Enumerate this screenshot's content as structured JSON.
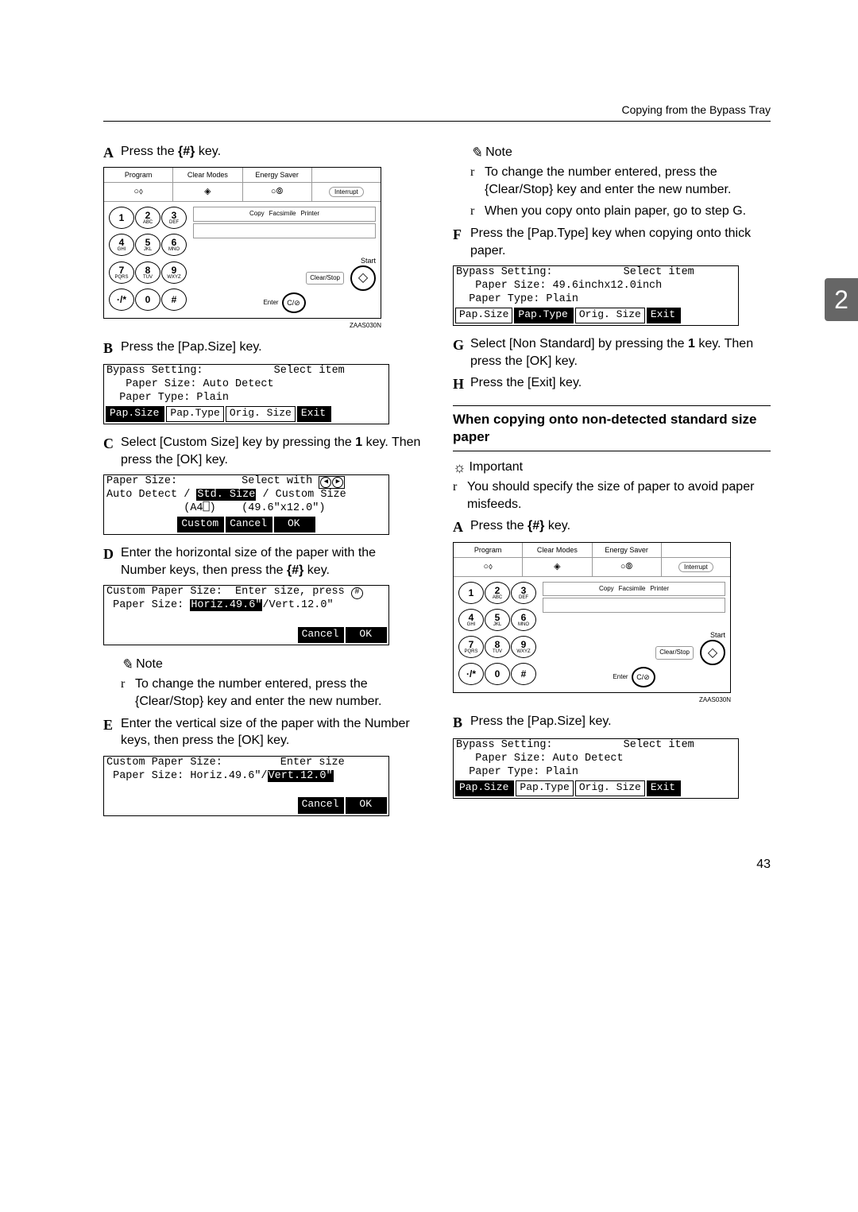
{
  "header": {
    "running": "Copying from the Bypass Tray"
  },
  "side_tab": "2",
  "page_number": "43",
  "img_code": "ZAAS030N",
  "panel": {
    "top": [
      "Program",
      "Clear Modes",
      "Energy Saver",
      ""
    ],
    "interrupt": "Interrupt",
    "keys": {
      "1": "1",
      "2": "2",
      "2s": "ABC",
      "3": "3",
      "3s": "DEF",
      "4": "4",
      "4s": "GHI",
      "5": "5",
      "5s": "JKL",
      "6": "6",
      "6s": "MNO",
      "7": "7",
      "7s": "PQRS",
      "8": "8",
      "8s": "TUV",
      "9": "9",
      "9s": "WXYZ",
      "dot": "·/*",
      "0": "0",
      "hash": "#"
    },
    "copy": "Copy",
    "fax": "Facsimile",
    "printer": "Printer",
    "start": "Start",
    "clearstop": "Clear/Stop",
    "enter": "Enter",
    "cstop": "C/⊘"
  },
  "left": {
    "A": {
      "pre": "Press the",
      "key": "{#}",
      "post": "key."
    },
    "B": {
      "pre": "Press the",
      "key": "[Pap.Size]",
      "post": "key."
    },
    "lcd1": {
      "l1a": "Bypass Setting:",
      "l1b": "Select item",
      "l2": "   Paper Size: Auto Detect",
      "l3": "  Paper Type: Plain",
      "btns": [
        "Pap.Size",
        "Pap.Type",
        "Orig. Size",
        "Exit"
      ]
    },
    "C": "Select [Custom Size] key by pressing the 1 key. Then press the [OK] key.",
    "C_key1": "Custom Size",
    "C_key2": "1",
    "C_key3": "OK",
    "lcd2": {
      "l1a": "Paper Size:",
      "l1b": "Select with",
      "l2a": "Auto Detect / ",
      "l2b": "Std. Size",
      "l2c": " / Custom Size",
      "l3": "            (A4⎕)    (49.6\"x12.0\")",
      "btns": [
        "Custom",
        "Cancel",
        "OK"
      ]
    },
    "D": "Enter the horizontal size of the paper with the Number keys, then press the {#} key.",
    "D_key": "{#}",
    "lcd3": {
      "l1a": "Custom Paper Size:",
      "l1b": "Enter size, press",
      "l2a": " Paper Size: ",
      "l2b": "Horiz.49.6\"",
      "l2c": "/Vert.12.0\"",
      "btns": [
        "Cancel",
        "OK"
      ]
    },
    "note": "Note",
    "note_r1": "To change the number entered, press the {Clear/Stop} key and enter the new number.",
    "note_r1_key": "Clear/Stop",
    "E": "Enter the vertical size of the paper with the Number keys, then press the [OK] key.",
    "E_key": "OK",
    "lcd4": {
      "l1a": "Custom Paper Size:",
      "l1b": "Enter size",
      "l2a": " Paper Size: Horiz.49.6\"/",
      "l2b": "Vert.12.0\"",
      "btns": [
        "Cancel",
        "OK"
      ]
    }
  },
  "right": {
    "note": "Note",
    "r1": "To change the number entered, press the {Clear/Stop} key and enter the new number.",
    "r1_key": "Clear/Stop",
    "r2": "When you copy onto plain paper, go to step G.",
    "r2_step": "G",
    "F": "Press the [Pap.Type] key when copying onto thick paper.",
    "F_key": "Pap.Type",
    "lcd5": {
      "l1a": "Bypass Setting:",
      "l1b": "Select item",
      "l2": "   Paper Size: 49.6inchx12.0inch",
      "l3": "  Paper Type: Plain",
      "btns": [
        "Pap.Size",
        "Pap.Type",
        "Orig. Size",
        "Exit"
      ]
    },
    "G": "Select [Non Standard] by pressing the 1 key. Then press the [OK] key.",
    "G_key1": "Non Standard",
    "G_key2": "1",
    "G_key3": "OK",
    "H": "Press the [Exit] key.",
    "H_key": "Exit",
    "section": "When copying onto non-detected standard size paper",
    "important": "Important",
    "imp_r": "You should specify the size of paper to avoid paper misfeeds.",
    "A2": {
      "pre": "Press the",
      "key": "{#}",
      "post": "key."
    },
    "B2": {
      "pre": "Press the",
      "key": "[Pap.Size]",
      "post": "key."
    },
    "lcd6": {
      "l1a": "Bypass Setting:",
      "l1b": "Select item",
      "l2": "   Paper Size: Auto Detect",
      "l3": "  Paper Type: Plain",
      "btns": [
        "Pap.Size",
        "Pap.Type",
        "Orig. Size",
        "Exit"
      ]
    }
  }
}
